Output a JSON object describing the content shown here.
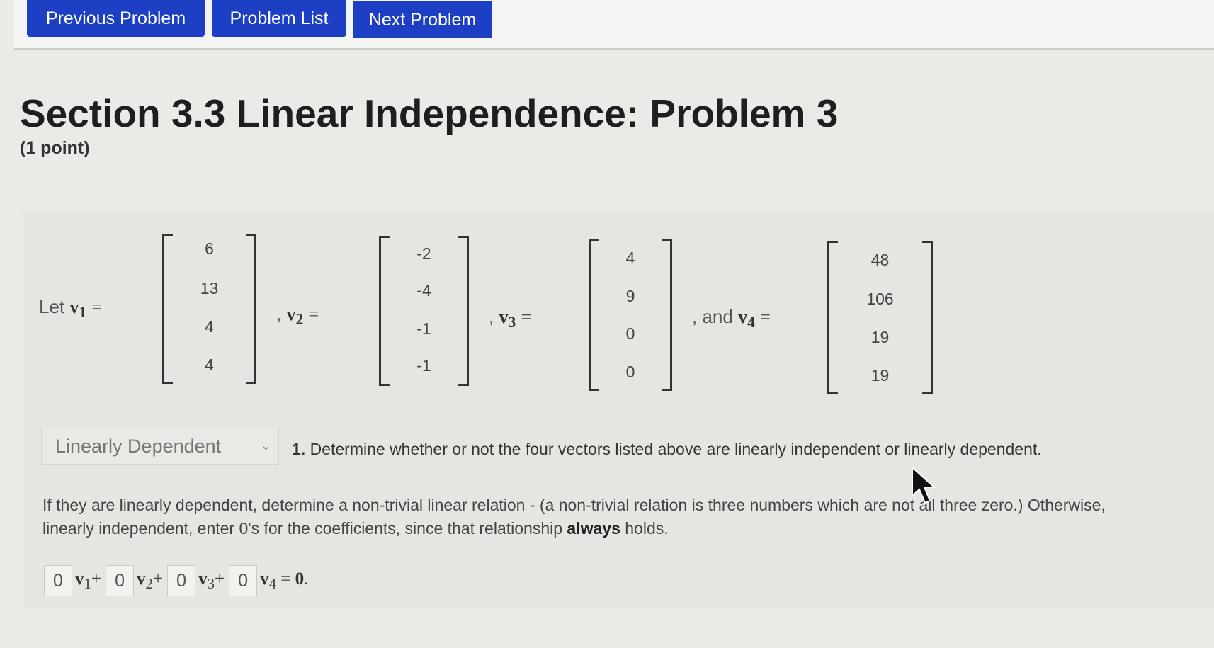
{
  "nav": {
    "previous": "Previous Problem",
    "list": "Problem List",
    "next": "Next Problem"
  },
  "title": "Section 3.3 Linear Independence: Problem 3",
  "points": "(1 point)",
  "vectors": {
    "let_prefix": "Let",
    "v1": {
      "name": "v",
      "sub": "1",
      "values": [
        "6",
        "13",
        "4",
        "4"
      ]
    },
    "v2": {
      "name": "v",
      "sub": "2",
      "values": [
        "-2",
        "-4",
        "-1",
        "-1"
      ]
    },
    "v3": {
      "name": "v",
      "sub": "3",
      "values": [
        "4",
        "9",
        "0",
        "0"
      ]
    },
    "v4": {
      "name": "v",
      "sub": "4",
      "values": [
        "48",
        "106",
        "19",
        "19"
      ]
    },
    "and_text": ", and",
    "comma": ","
  },
  "question": {
    "dropdown_value": "Linearly Dependent",
    "number": "1.",
    "text": "Determine whether or not the four vectors listed above are linearly independent or linearly dependent."
  },
  "instructions": {
    "line1": "If they are linearly dependent, determine a non-trivial linear relation - (a non-trivial relation is three numbers which are not all three zero.) Otherwise,",
    "line2_pre": "linearly independent, enter 0's for the coefficients, since that relationship",
    "line2_bold": "always",
    "line2_post": "holds."
  },
  "equation": {
    "c1": "0",
    "c2": "0",
    "c3": "0",
    "c4": "0",
    "t1": "v",
    "t1sub": "1",
    "plus": "+",
    "t2": "v",
    "t2sub": "2",
    "t3": "v",
    "t3sub": "3",
    "t4": "v",
    "t4sub": "4",
    "equals": "=",
    "zero": "0",
    "period": "."
  }
}
